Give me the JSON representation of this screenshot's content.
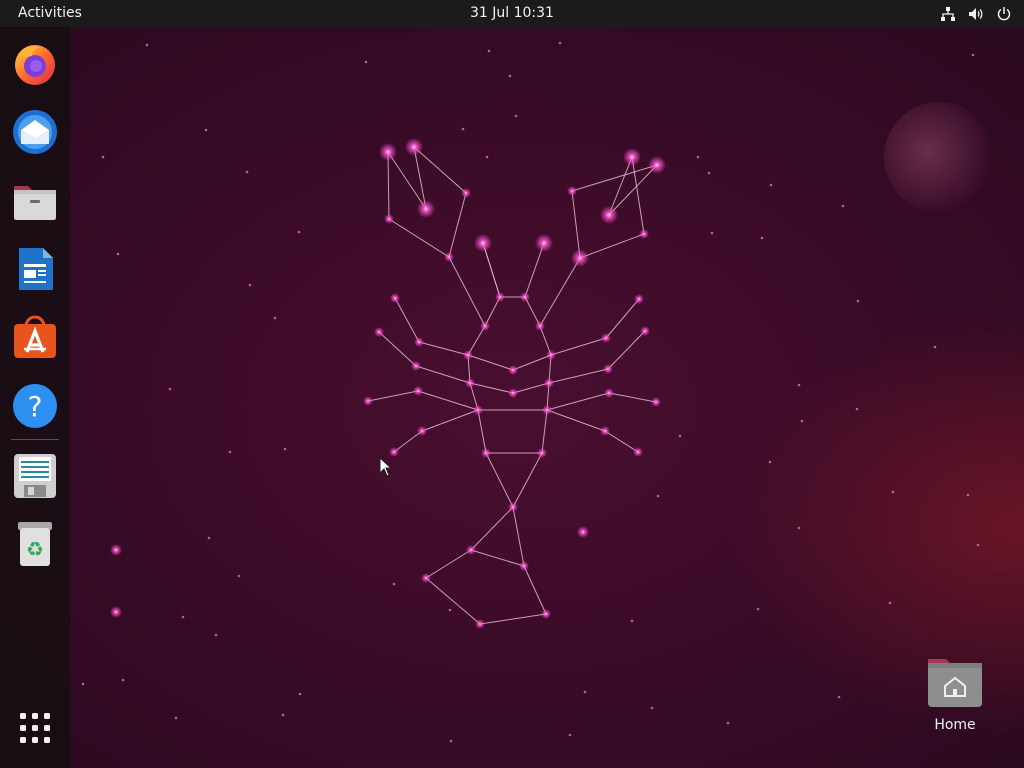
{
  "topbar": {
    "activities_label": "Activities",
    "clock": "31 Jul  10:31",
    "tray_icons": [
      "network-icon",
      "volume-icon",
      "power-icon"
    ]
  },
  "dock": {
    "items": [
      {
        "name": "firefox",
        "icon": "firefox-icon"
      },
      {
        "name": "thunderbird",
        "icon": "thunderbird-icon"
      },
      {
        "name": "files",
        "icon": "files-icon"
      },
      {
        "name": "libreoffice-writer",
        "icon": "writer-icon"
      },
      {
        "name": "ubuntu-software",
        "icon": "software-store-icon"
      },
      {
        "name": "help",
        "icon": "help-icon"
      },
      {
        "name": "disk-image",
        "icon": "disk-icon"
      },
      {
        "name": "trash",
        "icon": "trash-icon"
      }
    ],
    "show_apps_icon": "app-grid-icon"
  },
  "desktop": {
    "home_label": "Home",
    "wallpaper": "lobster-constellation"
  },
  "colors": {
    "topbar_bg": "#1b1b1b",
    "dock_bg": "#180e14",
    "wallpaper_bg": "#3a0b27",
    "star": "#ff4fd0"
  }
}
